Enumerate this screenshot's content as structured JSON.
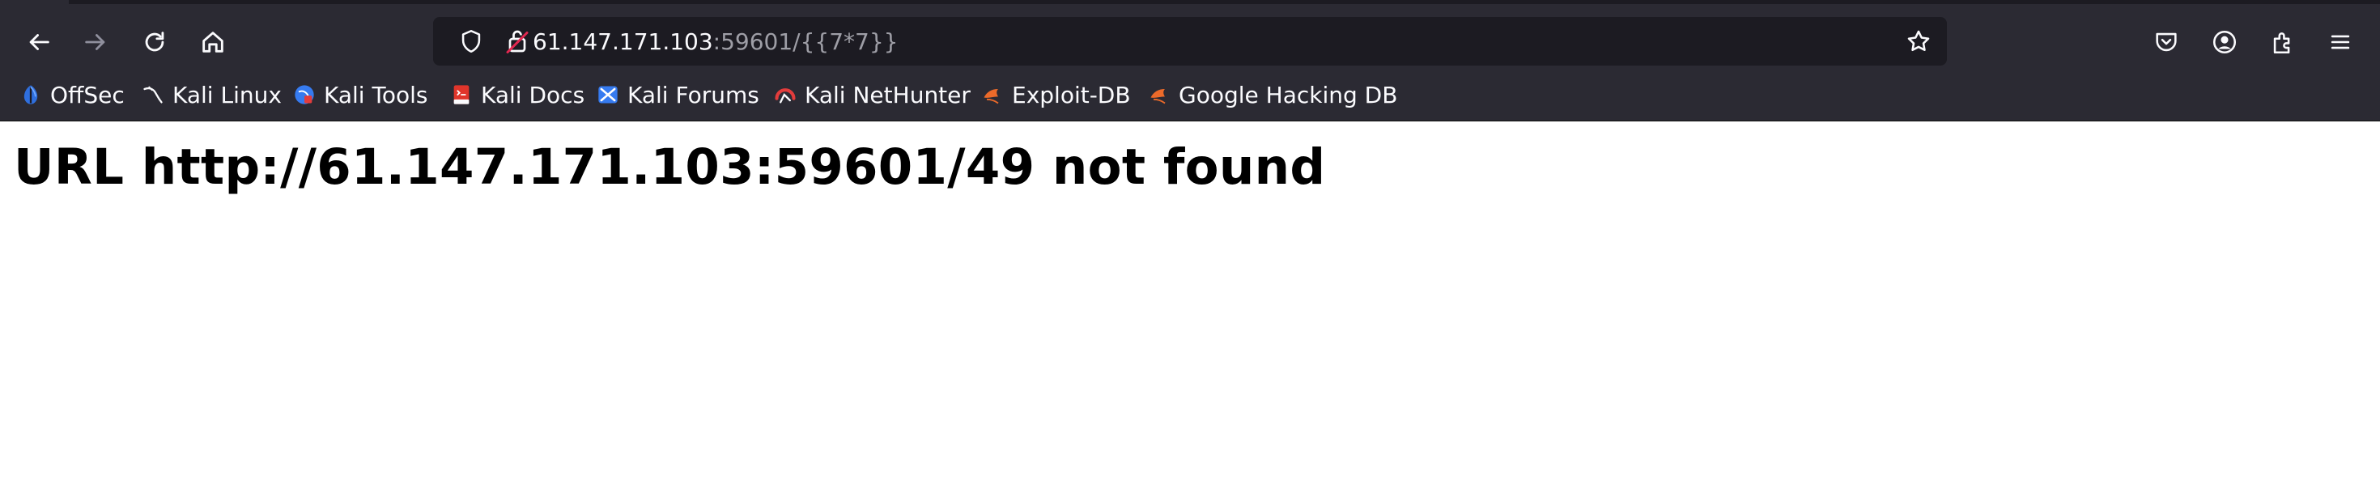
{
  "browser": {
    "url_host": "61.147.171.103",
    "url_rest": ":59601/{{7*7}}"
  },
  "bookmarks": [
    {
      "label": "OffSec",
      "icon": "offsec-icon"
    },
    {
      "label": "Kali Linux",
      "icon": "kali-linux-icon"
    },
    {
      "label": "Kali Tools",
      "icon": "kali-tools-icon"
    },
    {
      "label": "Kali Docs",
      "icon": "kali-docs-icon"
    },
    {
      "label": "Kali Forums",
      "icon": "kali-forums-icon"
    },
    {
      "label": "Kali NetHunter",
      "icon": "kali-nethunter-icon"
    },
    {
      "label": "Exploit-DB",
      "icon": "exploit-db-icon"
    },
    {
      "label": "Google Hacking DB",
      "icon": "google-hacking-db-icon"
    }
  ],
  "page": {
    "heading": "URL http://61.147.171.103:59601/49 not found"
  },
  "colors": {
    "toolbar": "#2b2a33",
    "urlbar": "#1c1b22",
    "text_light": "#fbfbfe",
    "text_muted": "#9e9ea6"
  }
}
